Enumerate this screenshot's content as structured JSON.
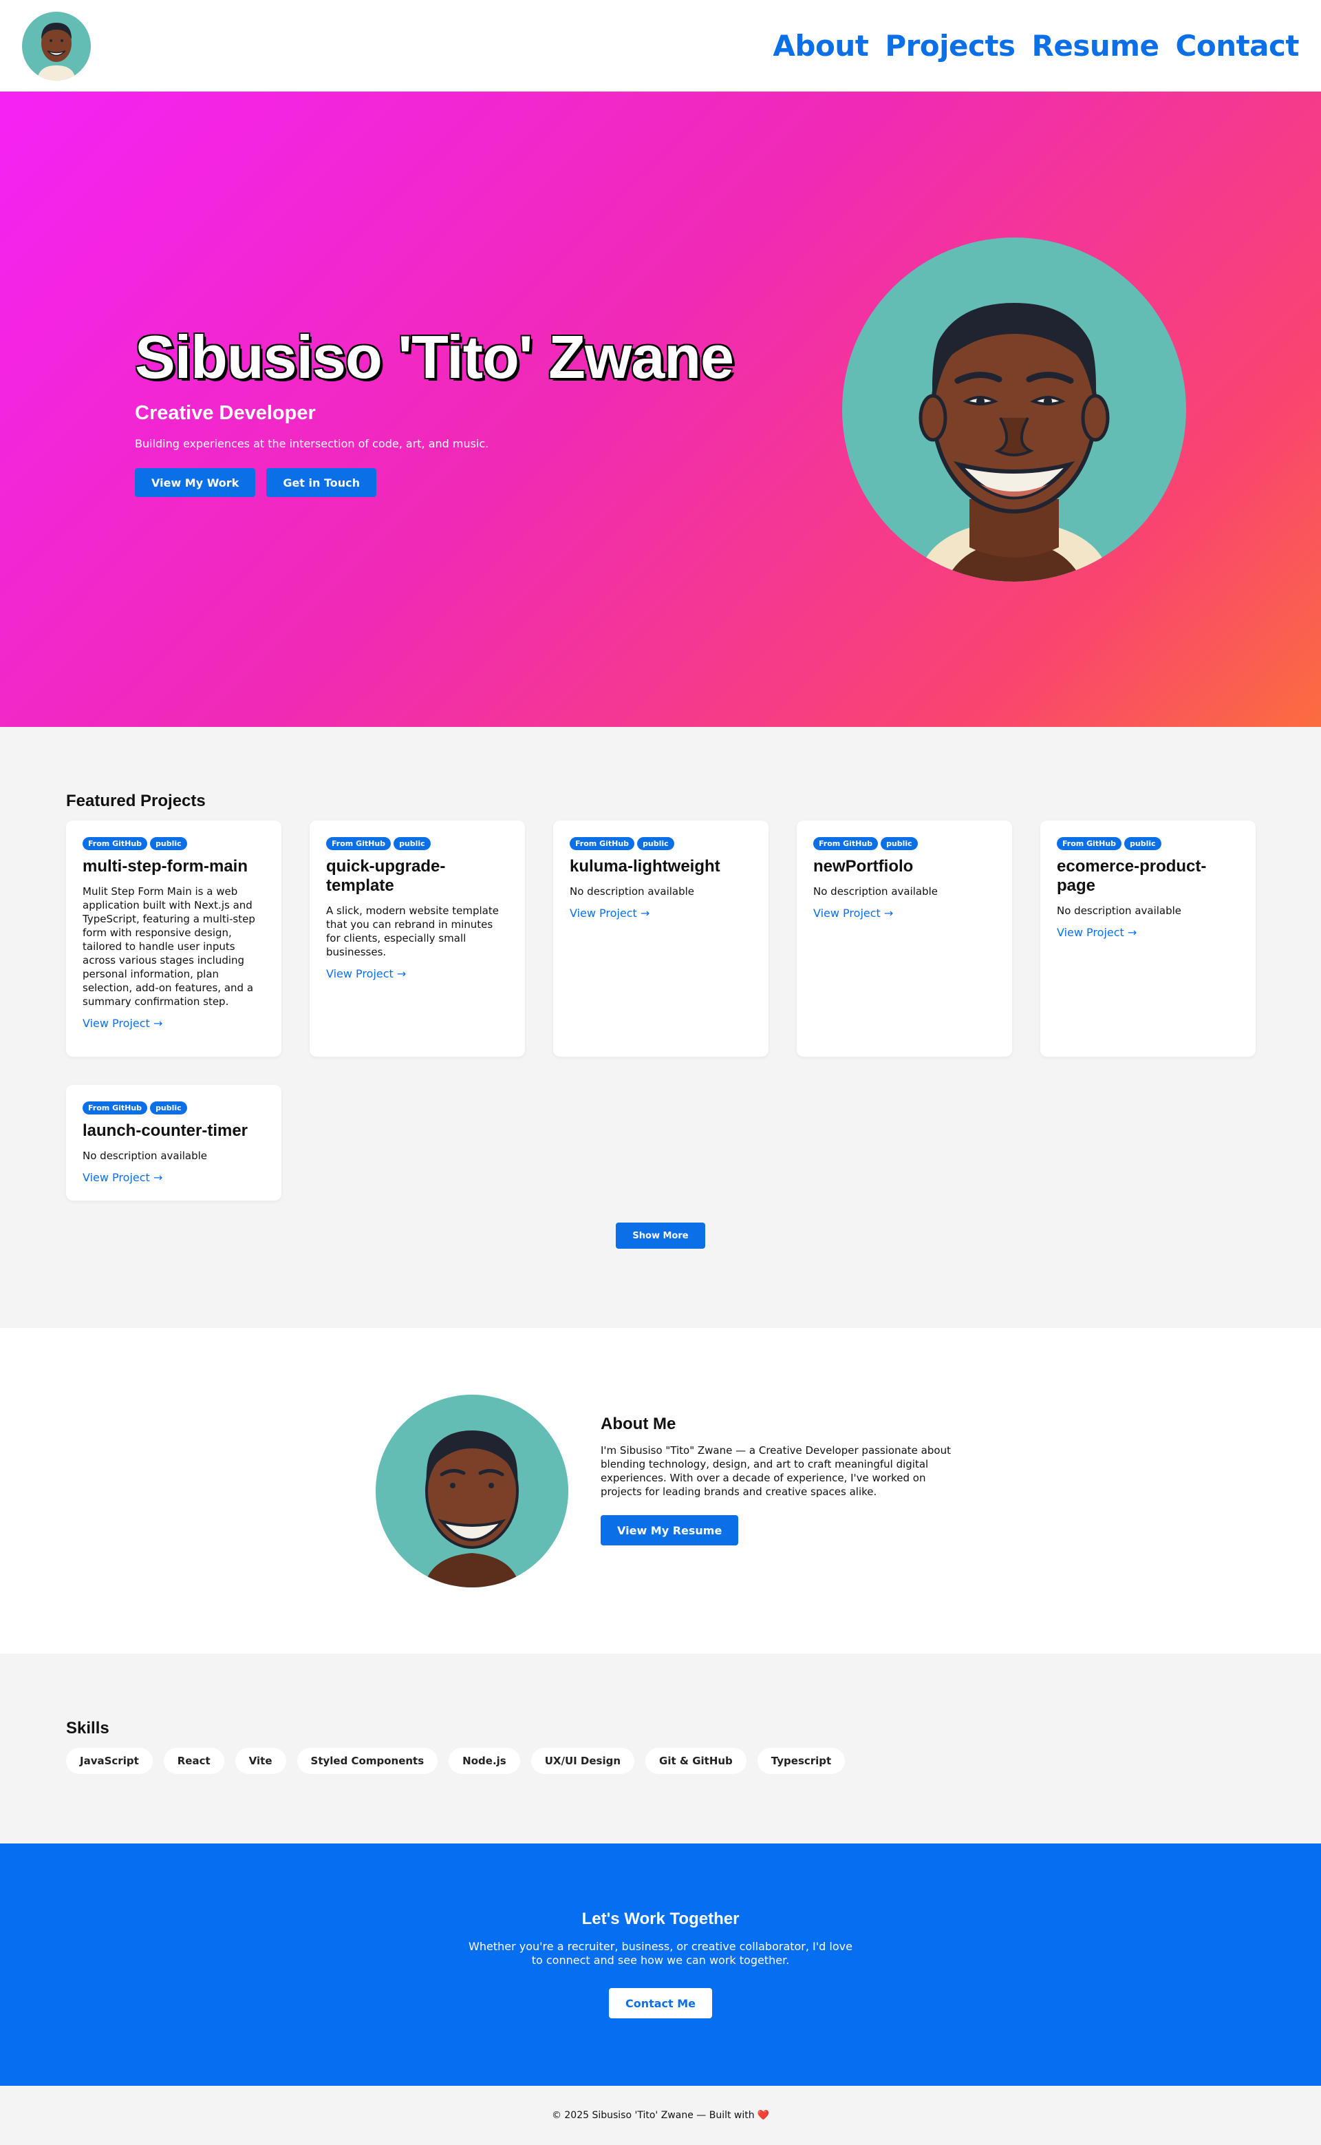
{
  "nav": {
    "links": [
      "About",
      "Projects",
      "Resume",
      "Contact"
    ]
  },
  "hero": {
    "name": "Sibusiso 'Tito' Zwane",
    "role": "Creative Developer",
    "tagline": "Building experiences at the intersection of code, art, and music.",
    "primary_button": "View My Work",
    "secondary_button": "Get in Touch"
  },
  "projects": {
    "heading": "Featured Projects",
    "badge_source": "From GitHub",
    "badge_visibility": "public",
    "link_label": "View Project →",
    "items": [
      {
        "title": "multi-step-form-main",
        "description": "Mulit Step Form Main is a web application built with Next.js and TypeScript, featuring a multi-step form with responsive design, tailored to handle user inputs across various stages including personal information, plan selection, add-on features, and a summary confirmation step."
      },
      {
        "title": "quick-upgrade-template",
        "description": "A slick, modern website template that you can rebrand in minutes for clients, especially small businesses."
      },
      {
        "title": "kuluma-lightweight",
        "description": "No description available"
      },
      {
        "title": "newPortfiolo",
        "description": "No description available"
      },
      {
        "title": "ecomerce-product-page",
        "description": "No description available"
      },
      {
        "title": "launch-counter-timer",
        "description": "No description available"
      }
    ],
    "show_more": "Show More"
  },
  "about": {
    "title": "About Me",
    "body": "I'm Sibusiso \"Tito\" Zwane — a Creative Developer passionate about blending technology, design, and art to craft meaningful digital experiences. With over a decade of experience, I've worked on projects for leading brands and creative spaces alike.",
    "button": "View My Resume"
  },
  "skills": {
    "heading": "Skills",
    "items": [
      "JavaScript",
      "React",
      "Vite",
      "Styled Components",
      "Node.js",
      "UX/UI Design",
      "Git & GitHub",
      "Typescript"
    ]
  },
  "cta": {
    "title": "Let's Work Together",
    "text": "Whether you're a recruiter, business, or creative collaborator, I'd love to connect and see how we can work together.",
    "button": "Contact Me"
  },
  "footer": {
    "text": "© 2025 Sibusiso 'Tito' Zwane — Built with",
    "heart": "❤️"
  },
  "colors": {
    "accent": "#0b6fe8",
    "avatar_bg": "#64bdb5",
    "skin": "#7a4128",
    "hero_gradient_start": "#f522f5",
    "hero_gradient_end": "#fb6d40"
  },
  "icons": {
    "avatar": "cartoon-face-avatar",
    "heart": "heart-icon"
  }
}
